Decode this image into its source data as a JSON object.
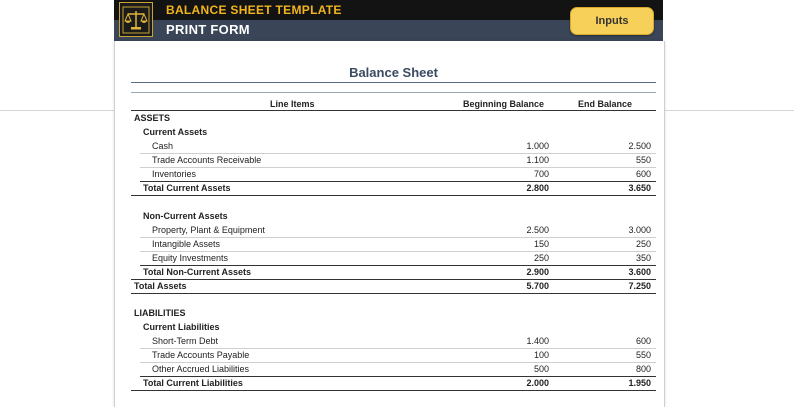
{
  "header": {
    "title": "BALANCE SHEET TEMPLATE",
    "subtitle": "PRINT FORM",
    "inputs_button": "Inputs",
    "logo_icon": "scales-of-justice-icon",
    "colors": {
      "accent": "#f2b51d",
      "header_bg": "#3a4558",
      "button": "#f7d05a"
    }
  },
  "sheet": {
    "title": "Balance Sheet",
    "columns": {
      "line_items": "Line Items",
      "beginning": "Beginning Balance",
      "end": "End Balance"
    },
    "assets": {
      "label": "ASSETS",
      "current": {
        "label": "Current Assets",
        "items": [
          {
            "name": "Cash",
            "begin": "1.000",
            "end": "2.500"
          },
          {
            "name": "Trade Accounts Receivable",
            "begin": "1.100",
            "end": "550"
          },
          {
            "name": "Inventories",
            "begin": "700",
            "end": "600"
          }
        ],
        "total": {
          "name": "Total Current Assets",
          "begin": "2.800",
          "end": "3.650"
        }
      },
      "noncurrent": {
        "label": "Non-Current Assets",
        "items": [
          {
            "name": "Property, Plant & Equipment",
            "begin": "2.500",
            "end": "3.000"
          },
          {
            "name": "Intangible Assets",
            "begin": "150",
            "end": "250"
          },
          {
            "name": "Equity Investments",
            "begin": "250",
            "end": "350"
          }
        ],
        "total": {
          "name": "Total Non-Current Assets",
          "begin": "2.900",
          "end": "3.600"
        }
      },
      "total": {
        "name": "Total Assets",
        "begin": "5.700",
        "end": "7.250"
      }
    },
    "liabilities": {
      "label": "LIABILITIES",
      "current": {
        "label": "Current Liabilities",
        "items": [
          {
            "name": "Short-Term Debt",
            "begin": "1.400",
            "end": "600"
          },
          {
            "name": "Trade Accounts Payable",
            "begin": "100",
            "end": "550"
          },
          {
            "name": "Other Accrued Liabilities",
            "begin": "500",
            "end": "800"
          }
        ],
        "total": {
          "name": "Total Current Liabilities",
          "begin": "2.000",
          "end": "1.950"
        }
      }
    }
  }
}
